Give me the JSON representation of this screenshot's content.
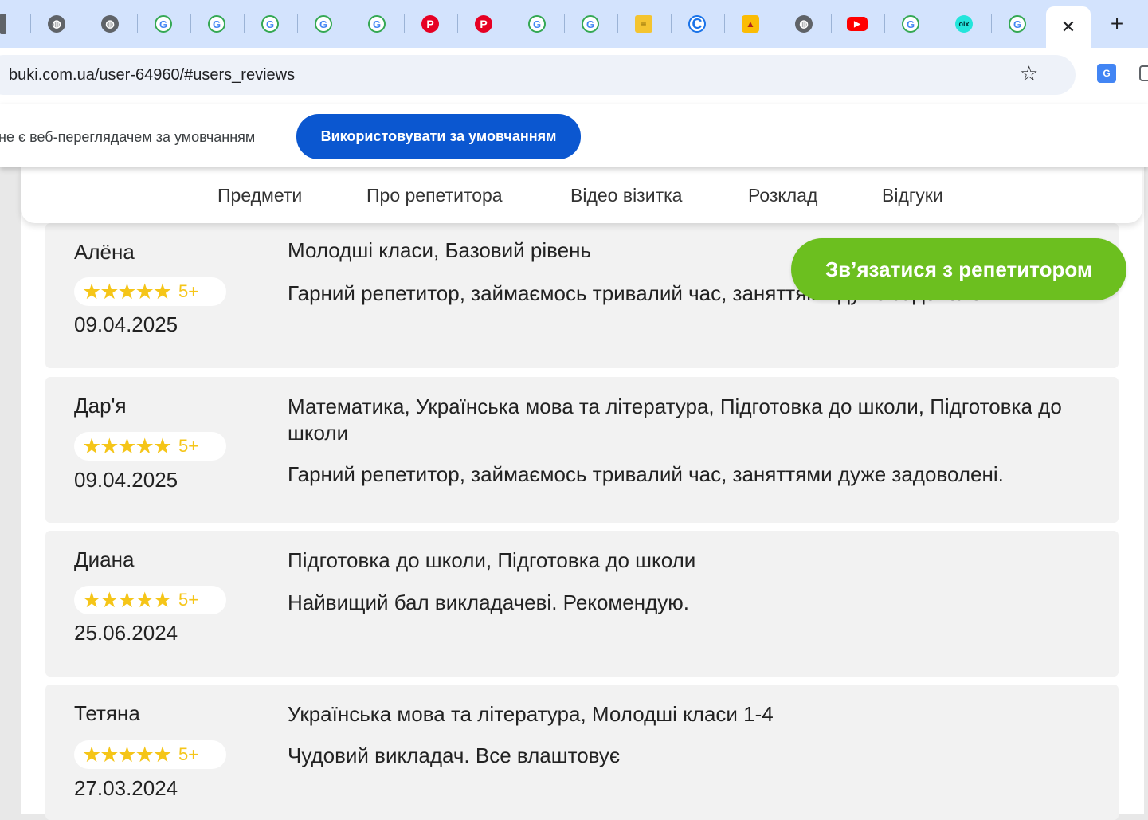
{
  "browser": {
    "tabs": [
      {
        "icon": "gray-bar-icon"
      },
      {
        "icon": "globe-icon"
      },
      {
        "icon": "globe-icon"
      },
      {
        "icon": "google-icon"
      },
      {
        "icon": "google-icon"
      },
      {
        "icon": "google-icon"
      },
      {
        "icon": "google-icon"
      },
      {
        "icon": "google-icon"
      },
      {
        "icon": "pinterest-icon"
      },
      {
        "icon": "pinterest-icon"
      },
      {
        "icon": "google-icon"
      },
      {
        "icon": "google-icon"
      },
      {
        "icon": "notes-icon"
      },
      {
        "icon": "c-icon"
      },
      {
        "icon": "bell-icon"
      },
      {
        "icon": "globe-icon"
      },
      {
        "icon": "youtube-icon"
      },
      {
        "icon": "google-icon"
      },
      {
        "icon": "olx-icon"
      },
      {
        "icon": "google-icon"
      }
    ],
    "active_tab_close": "✕",
    "new_tab": "+",
    "url": "buki.com.ua/user-64960/#users_reviews"
  },
  "infobar": {
    "text": "не є веб-переглядачем за умовчанням",
    "button": "Використовувати за умовчанням"
  },
  "nav": {
    "items": [
      "Предмети",
      "Про репетитора",
      "Відео візитка",
      "Розклад",
      "Відгуки"
    ]
  },
  "contact_button": "Зв’язатися з репетитором",
  "reviews": [
    {
      "name": "Алёна",
      "stars": "★★★★★",
      "grade": "5+",
      "date": "09.04.2025",
      "subjects": "Молодші класи, Базовий рівень",
      "text": "Гарний репетитор, займаємось тривалий час, заняттями дуже задоволені."
    },
    {
      "name": "Дар'я",
      "stars": "★★★★★",
      "grade": "5+",
      "date": "09.04.2025",
      "subjects": "Математика, Українська мова та література, Підготовка до школи, Підготовка до школи",
      "text": "Гарний репетитор, займаємось тривалий час, заняттями дуже задоволені."
    },
    {
      "name": "Диана",
      "stars": "★★★★★",
      "grade": "5+",
      "date": "25.06.2024",
      "subjects": "Підготовка до школи, Підготовка до школи",
      "text": "Найвищий бал викладачеві. Рекомендую."
    },
    {
      "name": "Тетяна",
      "stars": "★★★★★",
      "grade": "5+",
      "date": "27.03.2024",
      "subjects": "Українська мова та література, Молодші класи 1-4",
      "text": "Чудовий викладач. Все влаштовує"
    }
  ]
}
